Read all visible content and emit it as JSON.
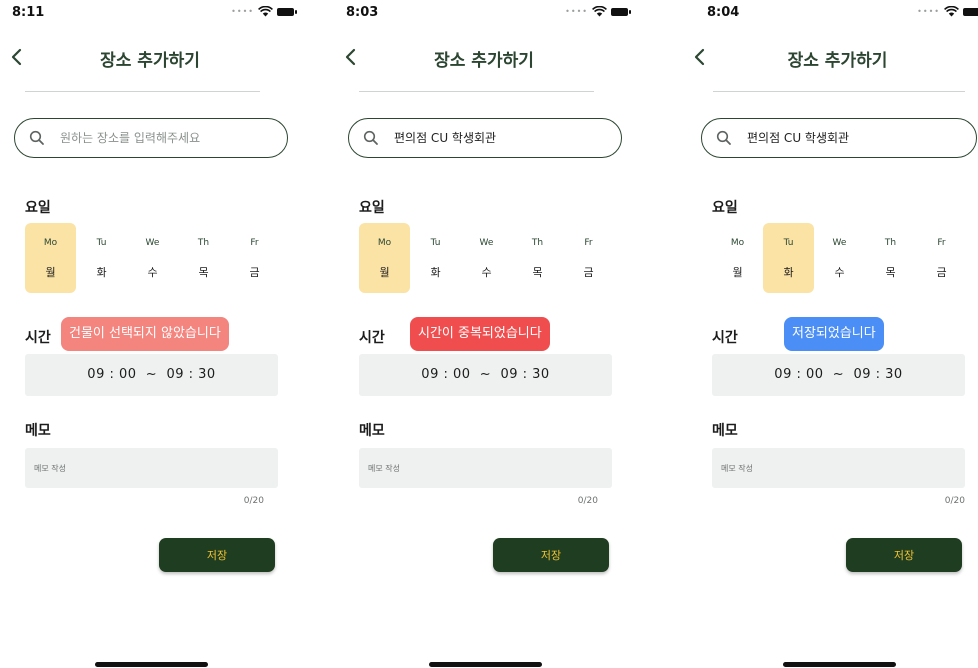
{
  "colors": {
    "brand_green": "#2c4632",
    "save_button_bg": "#1f3d21",
    "save_button_text": "#f2c230",
    "selected_day_bg": "#fbe3a5",
    "field_bg": "#eef1f0"
  },
  "screens": [
    {
      "status_time": "8:11",
      "title": "장소 추가하기",
      "search": {
        "value": "",
        "placeholder": "원하는 장소를 입력해주세요"
      },
      "days_label": "요일",
      "days": [
        {
          "en": "Mo",
          "ko": "월",
          "selected": true
        },
        {
          "en": "Tu",
          "ko": "화",
          "selected": false
        },
        {
          "en": "We",
          "ko": "수",
          "selected": false
        },
        {
          "en": "Th",
          "ko": "목",
          "selected": false
        },
        {
          "en": "Fr",
          "ko": "금",
          "selected": false
        }
      ],
      "time_label": "시간",
      "toast": {
        "text": "건물이 선택되지 않았습니다",
        "color": "#f3847e"
      },
      "time_start": "09 : 00",
      "time_sep": "~",
      "time_end": "09 : 30",
      "memo_label": "메모",
      "memo": {
        "value": "",
        "placeholder": "메모 작성"
      },
      "memo_counter": "0/20",
      "save_label": "저장"
    },
    {
      "status_time": "8:03",
      "title": "장소 추가하기",
      "search": {
        "value": "편의점 CU 학생회관",
        "placeholder": "원하는 장소를 입력해주세요"
      },
      "days_label": "요일",
      "days": [
        {
          "en": "Mo",
          "ko": "월",
          "selected": true
        },
        {
          "en": "Tu",
          "ko": "화",
          "selected": false
        },
        {
          "en": "We",
          "ko": "수",
          "selected": false
        },
        {
          "en": "Th",
          "ko": "목",
          "selected": false
        },
        {
          "en": "Fr",
          "ko": "금",
          "selected": false
        }
      ],
      "time_label": "시간",
      "toast": {
        "text": "시간이 중복되었습니다",
        "color": "#f04e4e"
      },
      "time_start": "09 : 00",
      "time_sep": "~",
      "time_end": "09 : 30",
      "memo_label": "메모",
      "memo": {
        "value": "",
        "placeholder": "메모 작성"
      },
      "memo_counter": "0/20",
      "save_label": "저장"
    },
    {
      "status_time": "8:04",
      "title": "장소 추가하기",
      "search": {
        "value": "편의점 CU 학생회관",
        "placeholder": "원하는 장소를 입력해주세요"
      },
      "days_label": "요일",
      "days": [
        {
          "en": "Mo",
          "ko": "월",
          "selected": false
        },
        {
          "en": "Tu",
          "ko": "화",
          "selected": true
        },
        {
          "en": "We",
          "ko": "수",
          "selected": false
        },
        {
          "en": "Th",
          "ko": "목",
          "selected": false
        },
        {
          "en": "Fr",
          "ko": "금",
          "selected": false
        }
      ],
      "time_label": "시간",
      "toast": {
        "text": "저장되었습니다",
        "color": "#4b8ef5"
      },
      "time_start": "09 : 00",
      "time_sep": "~",
      "time_end": "09 : 30",
      "memo_label": "메모",
      "memo": {
        "value": "",
        "placeholder": "메모 작성"
      },
      "memo_counter": "0/20",
      "save_label": "저장"
    }
  ]
}
